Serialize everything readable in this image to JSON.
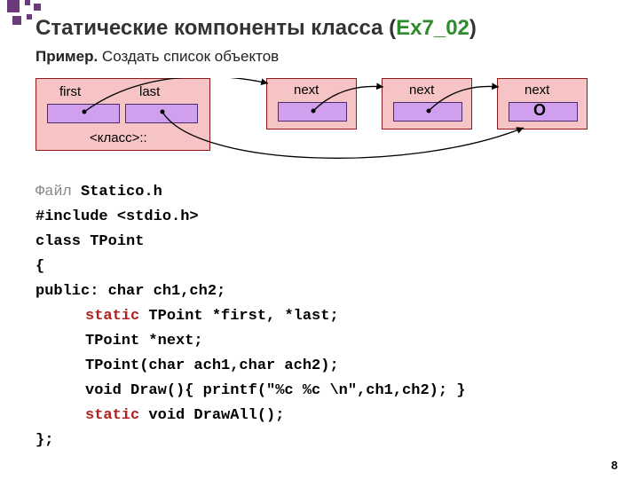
{
  "title_pre": "Статические компоненты класса (",
  "title_green": "Ex7_02",
  "title_post": ")",
  "subtitle_bold": "Пример.",
  "subtitle_rest": " Создать список объектов",
  "diagram": {
    "first": "first",
    "last": "last",
    "class_caption": "<класс>::",
    "next1": "next",
    "next2": "next",
    "next3": "next",
    "null": "O"
  },
  "code": {
    "l1a": "Файл",
    "l1b": " Statico.h",
    "l2": "#include <stdio.h>",
    "l3": "class TPoint",
    "l4": "{",
    "l5": "public:  char ch1,ch2;",
    "l6a": "static",
    "l6b": " TPoint *first, *last;",
    "l7": "TPoint *next;",
    "l8": "TPoint(char ach1,char ach2);",
    "l9": "void Draw(){ printf(\"%c   %c  \\n\",ch1,ch2); }",
    "l10a": "static",
    "l10b": " void DrawAll();",
    "l11": "};"
  },
  "pagenum": "8"
}
